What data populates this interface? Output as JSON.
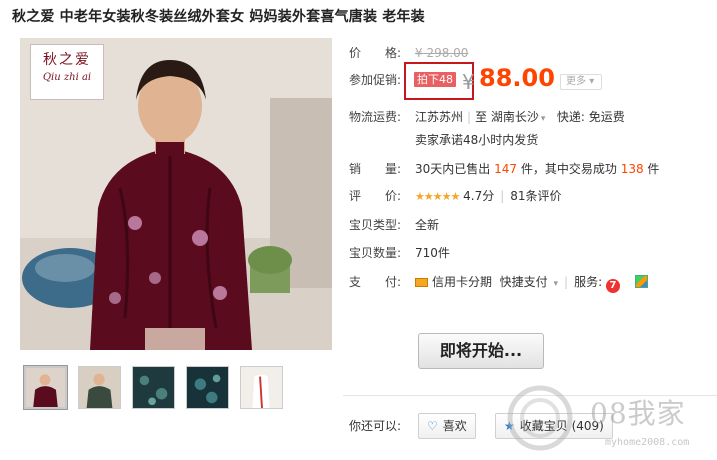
{
  "product": {
    "title": "秋之爱 中老年女装秋冬装丝绒外套女 妈妈装外套喜气唐装 老年装",
    "brand_cn": "秋之爱",
    "brand_pinyin": "Qiu zhi ai"
  },
  "price": {
    "label": "价　　格:",
    "original": "¥ 298.00"
  },
  "promo": {
    "label": "参加促销:",
    "tag": "拍下48",
    "currency": "¥",
    "price": "88.00",
    "more": "更多"
  },
  "shipping": {
    "label": "物流运费:",
    "from": "江苏苏州",
    "to_prefix": "至",
    "to": "湖南长沙",
    "express": "快递: 免运费",
    "promise": "卖家承诺48小时内发货"
  },
  "sales": {
    "label": "销　　量:",
    "prefix": "30天内已售出",
    "sold": "147",
    "middle": "件，其中交易成功",
    "success": "138",
    "suffix": "件"
  },
  "rating": {
    "label": "评　　价:",
    "stars": "★★★★★",
    "score": "4.7分",
    "reviews": "81条评价"
  },
  "condition": {
    "label": "宝贝类型:",
    "value": "全新"
  },
  "quantity": {
    "label": "宝贝数量:",
    "value": "710件"
  },
  "payment": {
    "label": "支　　付:",
    "credit": "信用卡分期",
    "quick": "快捷支付",
    "service_label": "服务:"
  },
  "actions": {
    "start_button": "即将开始...",
    "you_can": "你还可以:",
    "like": "喜欢",
    "collect": "收藏宝贝 (409)"
  },
  "watermark": {
    "text": "08我家",
    "url": "myhome2008.com"
  },
  "colors": {
    "price_orange": "#ff4400",
    "promo_red": "#c8161d",
    "star_gold": "#f5a623",
    "link_blue": "#1a7fd1"
  }
}
